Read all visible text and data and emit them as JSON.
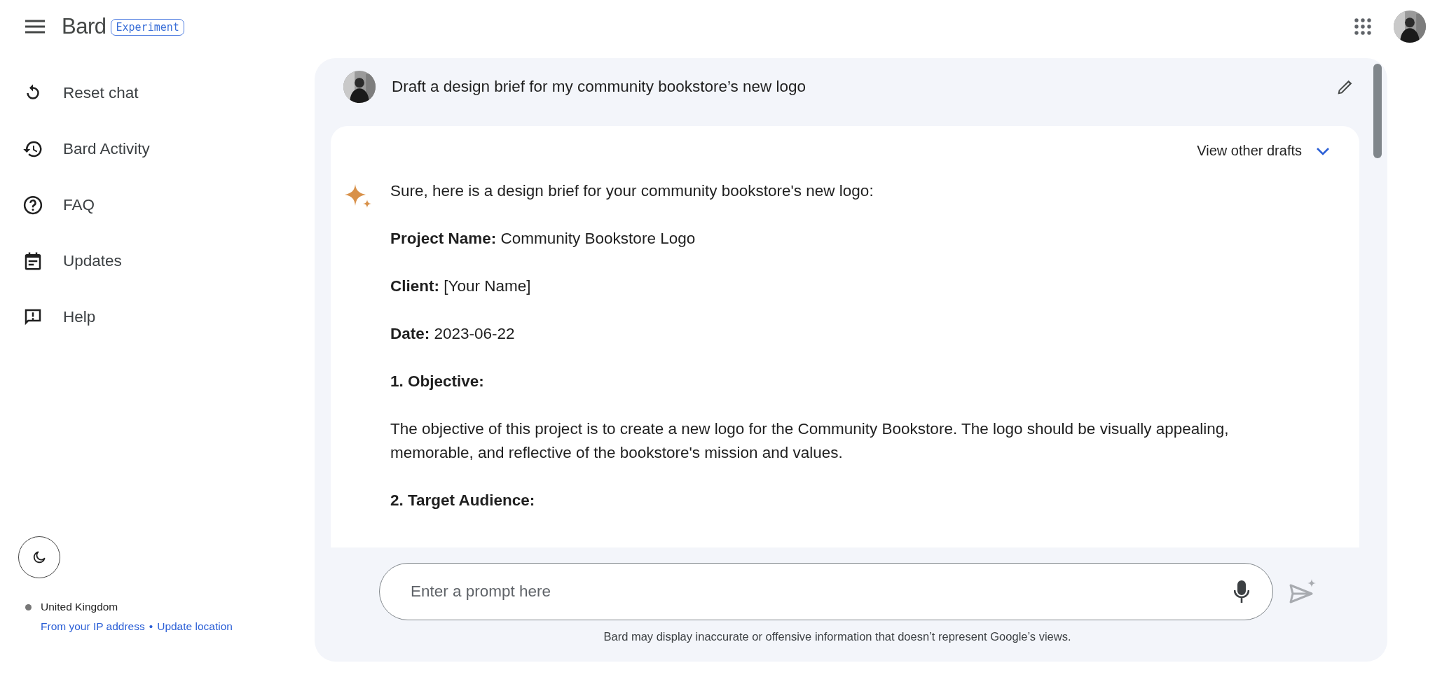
{
  "header": {
    "title": "Bard",
    "badge": "Experiment"
  },
  "sidebar": {
    "items": [
      {
        "label": "Reset chat",
        "kind": "reset"
      },
      {
        "label": "Bard Activity",
        "kind": "history"
      },
      {
        "label": "FAQ",
        "kind": "faq"
      },
      {
        "label": "Updates",
        "kind": "updates"
      },
      {
        "label": "Help",
        "kind": "help"
      }
    ],
    "location": {
      "country": "United Kingdom",
      "source_link": "From your IP address",
      "separator": "•",
      "update_link": "Update location"
    }
  },
  "chat": {
    "prompt": "Draft a design brief for my community bookstore’s new logo",
    "drafts_label": "View other drafts",
    "paragraphs": [
      {
        "kind": "text",
        "text": "Sure, here is a design brief for your community bookstore's new logo:"
      },
      {
        "kind": "text",
        "text": "**Project Name:** Community Bookstore Logo"
      },
      {
        "kind": "text",
        "text": "**Client:** [Your Name]"
      },
      {
        "kind": "text",
        "text": "**Date:** 2023-06-22"
      },
      {
        "kind": "heading",
        "text": "1. Objective:"
      },
      {
        "kind": "text",
        "text": "The objective of this project is to create a new logo for the Community Bookstore. The logo should be visually appealing, memorable, and reflective of the bookstore's mission and values."
      },
      {
        "kind": "heading",
        "text": "2. Target Audience:"
      }
    ]
  },
  "input": {
    "placeholder": "Enter a prompt here"
  },
  "disclaimer": "Bard may display inaccurate or offensive information that doesn’t represent Google’s views."
}
